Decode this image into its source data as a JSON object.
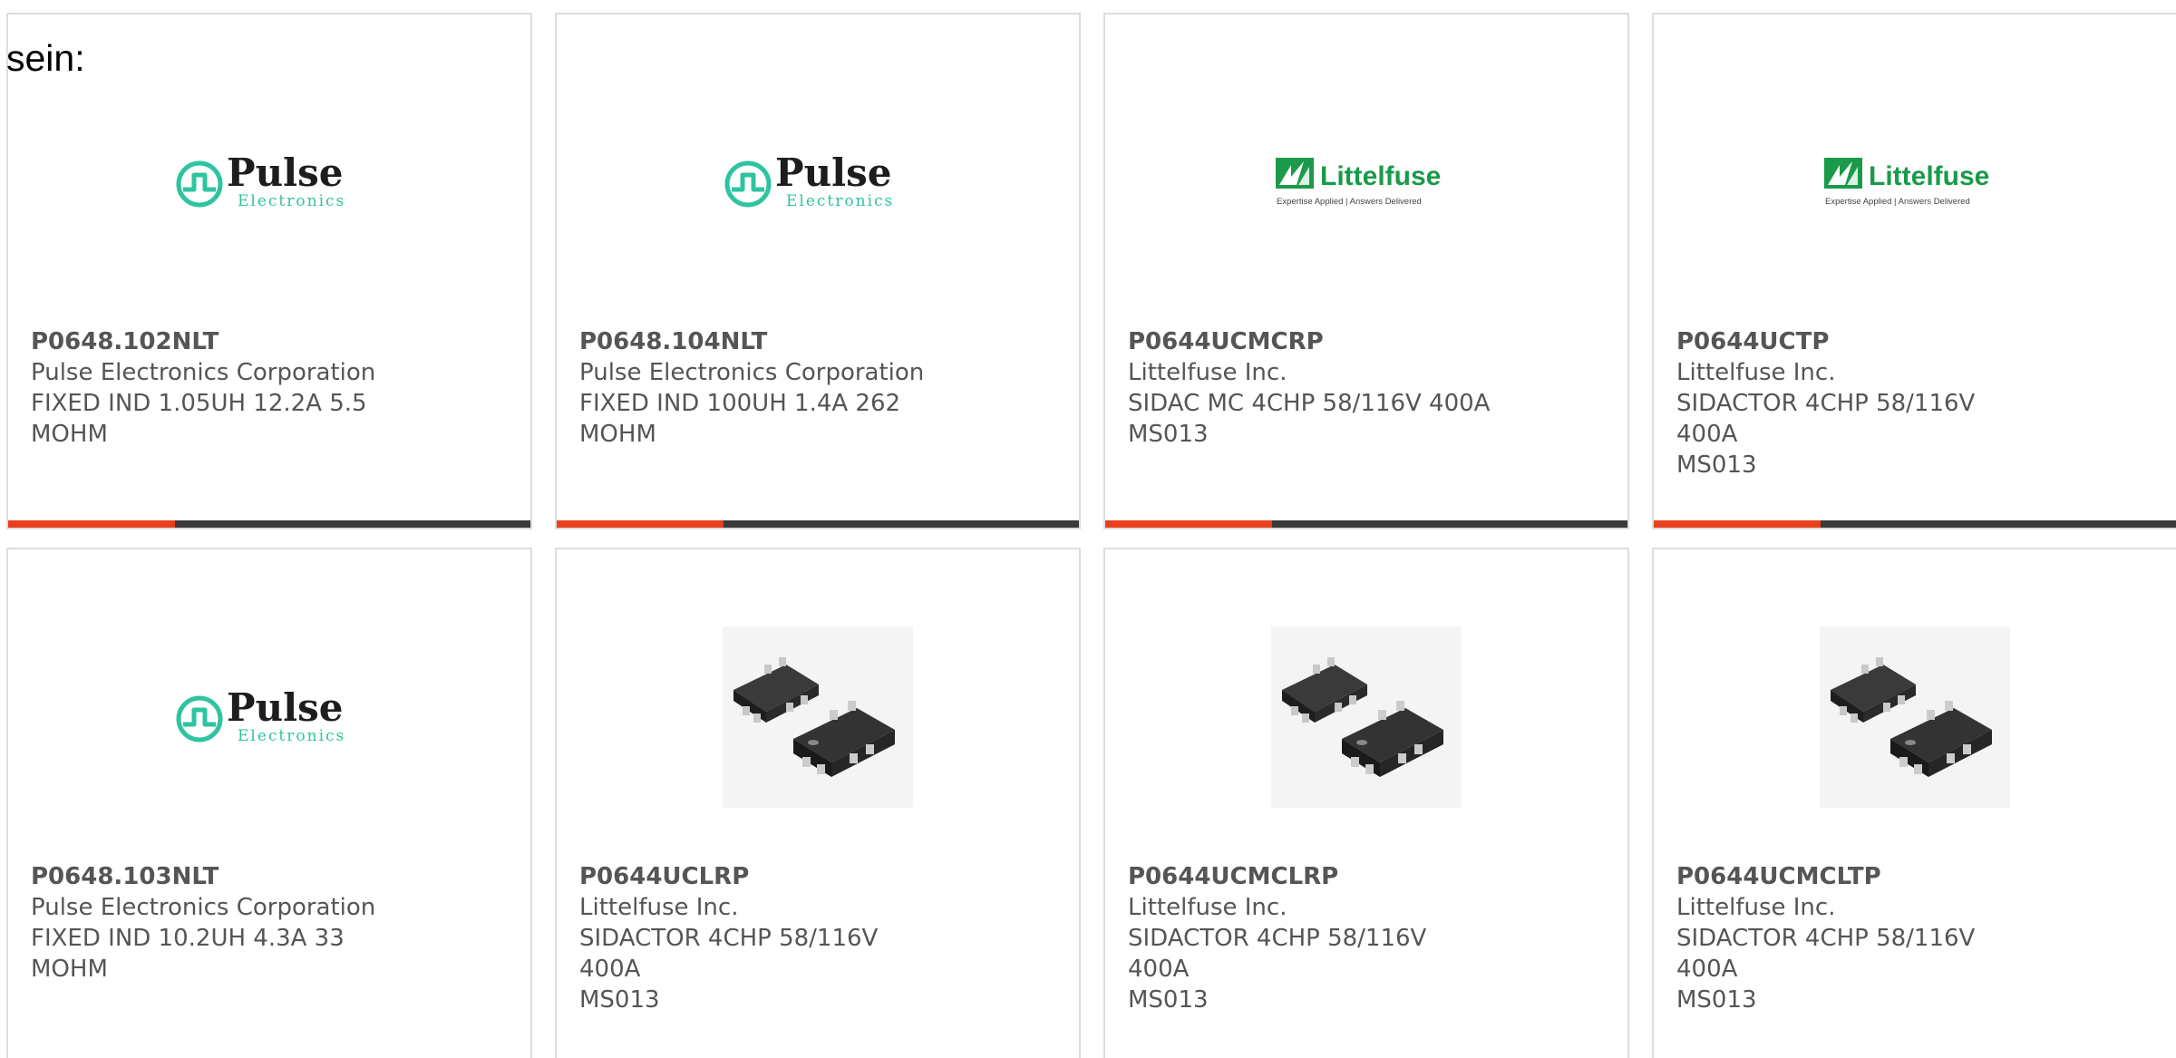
{
  "page": {
    "top_fragment": "sein:"
  },
  "colors": {
    "accent": "#e8401c",
    "bar_dark": "#3a3a3a",
    "pulse_teal": "#2dc4a0",
    "littelfuse_green": "#1a9a4a"
  },
  "accent_progress": 0.32,
  "cards": [
    {
      "part_number": "P0648.102NLT",
      "manufacturer": "Pulse Electronics Corporation",
      "description_1": "FIXED IND 1.05UH 12.2A 5.5",
      "description_2": "MOHM",
      "image": "pulse-electronics-logo"
    },
    {
      "part_number": "P0648.104NLT",
      "manufacturer": "Pulse Electronics Corporation",
      "description_1": "FIXED IND 100UH 1.4A 262",
      "description_2": "MOHM",
      "image": "pulse-electronics-logo"
    },
    {
      "part_number": "P0644UCMCRP",
      "manufacturer": "Littelfuse Inc.",
      "description_1": "SIDAC MC 4CHP 58/116V 400A",
      "description_2": "MS013",
      "image": "littelfuse-logo"
    },
    {
      "part_number": "P0644UCTP",
      "manufacturer": "Littelfuse Inc.",
      "description_1": "SIDACTOR 4CHP 58/116V 400A",
      "description_2": "MS013",
      "image": "littelfuse-logo"
    },
    {
      "part_number": "P0648.103NLT",
      "manufacturer": "Pulse Electronics Corporation",
      "description_1": "FIXED IND 10.2UH 4.3A 33",
      "description_2": "MOHM",
      "image": "pulse-electronics-logo"
    },
    {
      "part_number": "P0644UCLRP",
      "manufacturer": "Littelfuse Inc.",
      "description_1": "SIDACTOR 4CHP 58/116V 400A",
      "description_2": "MS013",
      "image": "chip-package-photo"
    },
    {
      "part_number": "P0644UCMCLRP",
      "manufacturer": "Littelfuse Inc.",
      "description_1": "SIDACTOR 4CHP 58/116V 400A",
      "description_2": "MS013",
      "image": "chip-package-photo"
    },
    {
      "part_number": "P0644UCMCLTP",
      "manufacturer": "Littelfuse Inc.",
      "description_1": "SIDACTOR 4CHP 58/116V 400A",
      "description_2": "MS013",
      "image": "chip-package-photo"
    }
  ],
  "logos": {
    "pulse": {
      "wordmark": "Pulse",
      "subline": "Electronics"
    },
    "littelfuse": {
      "wordmark": "Littelfuse",
      "tagline": "Expertise Applied | Answers Delivered"
    }
  }
}
